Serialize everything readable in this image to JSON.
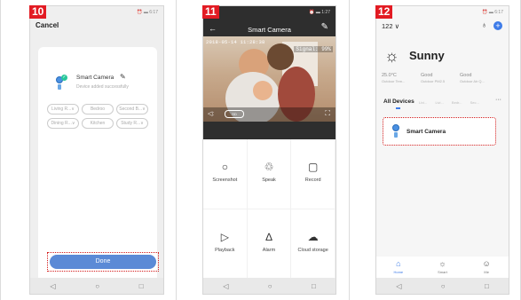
{
  "steps": [
    "10",
    "11",
    "12"
  ],
  "phone1": {
    "status_left": "▮ ↗ ≋",
    "status_right": "⏰ ▬ 6:17",
    "cancel": "Cancel",
    "device_name": "Smart Camera",
    "device_sub": "Device added successfully",
    "rooms": [
      "Living R...∨",
      "Bedroo",
      "Second B...∨",
      "Dining R...∨",
      "Kitchen",
      "Study R...∨"
    ],
    "done": "Done",
    "nav": [
      "◁",
      "○",
      "□"
    ]
  },
  "phone2": {
    "status_left": "▮ ↗ ≋",
    "status_right": "⏰ ▬ 1:27",
    "title": "Smart Camera",
    "timestamp": "2018-05-14  11:28:38",
    "signal": "Signal: 99%",
    "sd": "SD",
    "controls": [
      {
        "icon": "○",
        "label": "Screenshot"
      },
      {
        "icon": "♲",
        "label": "Speak"
      },
      {
        "icon": "▢",
        "label": "Record"
      },
      {
        "icon": "▷",
        "label": "Playback"
      },
      {
        "icon": "∆",
        "label": "Alarm"
      },
      {
        "icon": "☁",
        "label": "Cloud storage"
      }
    ],
    "nav": [
      "◁",
      "○",
      "□"
    ]
  },
  "phone3": {
    "status_left": "▮ ↗ ≋",
    "status_right": "⏰ ▬ 6:17",
    "home": "122 ∨",
    "weather": "Sunny",
    "stats": [
      {
        "value": "25.0°C",
        "key": "Outdoor Tem..."
      },
      {
        "value": "Good",
        "key": "Outdoor PM2.5"
      },
      {
        "value": "Good",
        "key": "Outdoor Air Q..."
      }
    ],
    "all_devices": "All Devices",
    "tabs": "Livi... Livi... Bedr... Sec...",
    "device": "Smart Camera",
    "bottom_nav": [
      {
        "icon": "⌂",
        "label": "Home"
      },
      {
        "icon": "☼",
        "label": "Smart"
      },
      {
        "icon": "☺",
        "label": "Me"
      }
    ],
    "nav": [
      "◁",
      "○",
      "□"
    ]
  }
}
